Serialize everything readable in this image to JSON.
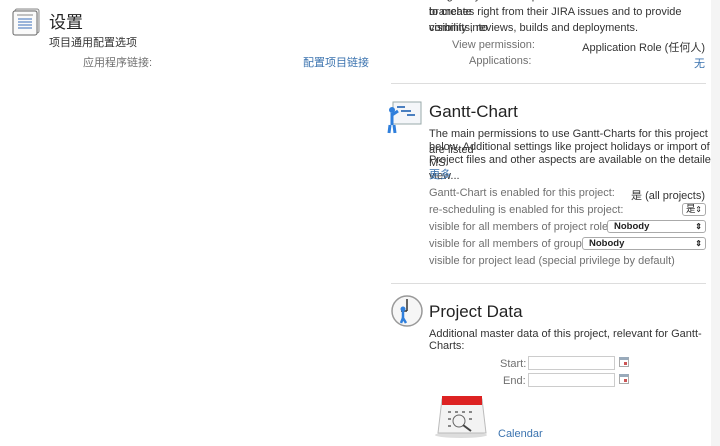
{
  "settings": {
    "title": "设置",
    "subtitle": "项目通用配置选项",
    "app_link_label": "应用程序链接:",
    "app_link_value": "配置项目链接"
  },
  "development": {
    "text_cut": "integrate your development tools with JIRA to allow users to create",
    "text_lines": [
      "branches right from their JIRA issues and to provide visibility into",
      "commits, reviews, builds and deployments."
    ],
    "view_permission_label": "View permission:",
    "view_permission_value": "Application Role (任何人)",
    "applications_label": "Applications:",
    "applications_value": "无"
  },
  "gantt": {
    "title": "Gantt-Chart",
    "desc_lines": [
      "The main permissions to use Gantt-Charts for this project are listed",
      "below. Additional settings like project holidays or import of MS",
      "Project files and other aspects are available on the detailed view..."
    ],
    "more": "更多",
    "enabled_label": "Gantt-Chart is enabled for this project:",
    "enabled_value": "是 (all projects)",
    "resched_label": "re-scheduling is enabled for this project:",
    "resched_value": "是",
    "role_label": "visible for all members of project role:",
    "role_value": "Nobody",
    "group_label": "visible for all members of group:",
    "group_value": "Nobody",
    "lead_label": "visible for project lead (special privilege by default)"
  },
  "project_data": {
    "title": "Project Data",
    "desc": "Additional master data of this project, relevant for Gantt-Charts:",
    "start_label": "Start:",
    "start_value": "",
    "end_label": "End:",
    "end_value": "",
    "calendar_link": "Calendar",
    "calendar_icon_text": "Calendar"
  }
}
